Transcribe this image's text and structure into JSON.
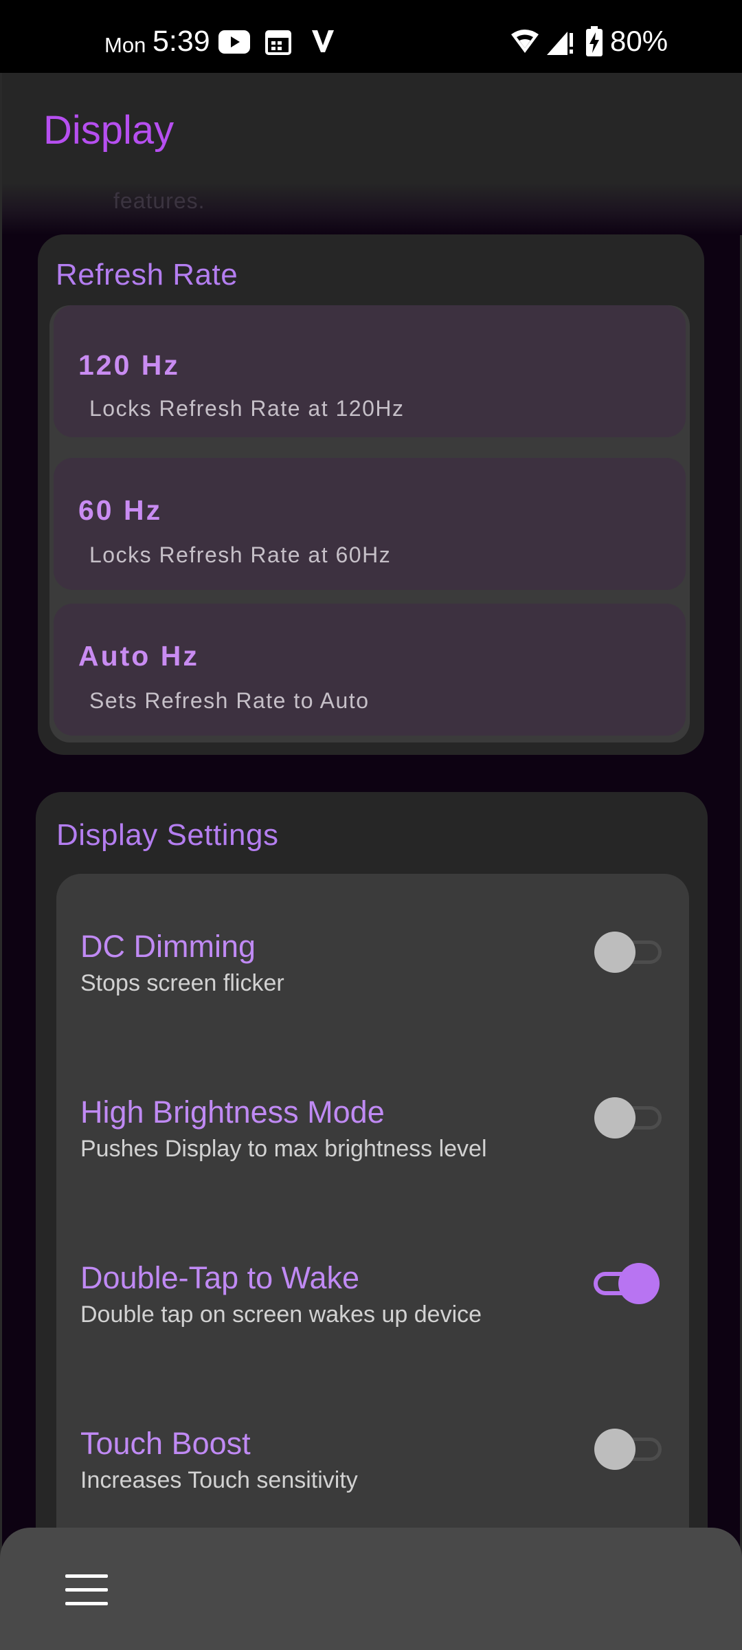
{
  "status_bar": {
    "day": "Mon",
    "time": "5:39",
    "battery": "80%",
    "icons": [
      "youtube-icon",
      "calendar-icon",
      "v-app-icon",
      "wifi-icon",
      "signal-icon",
      "battery-charging-icon"
    ]
  },
  "app_bar": {
    "title": "Display",
    "faded_text": "features."
  },
  "refresh_rate": {
    "title": "Refresh Rate",
    "options": [
      {
        "title": "120 Hz",
        "desc": "Locks Refresh Rate at 120Hz"
      },
      {
        "title": "60 Hz",
        "desc": "Locks Refresh Rate at 60Hz"
      },
      {
        "title": "Auto Hz",
        "desc": "Sets Refresh Rate to Auto"
      }
    ]
  },
  "display_settings": {
    "title": "Display Settings",
    "items": [
      {
        "title": "DC Dimming",
        "desc": "Stops screen flicker",
        "enabled": false
      },
      {
        "title": "High Brightness Mode",
        "desc": "Pushes Display to max brightness level",
        "enabled": false
      },
      {
        "title": "Double-Tap to Wake",
        "desc": "Double tap on screen wakes up device",
        "enabled": true
      },
      {
        "title": "Touch Boost",
        "desc": "Increases Touch sensitivity",
        "enabled": false
      }
    ]
  },
  "bottom_bar": {
    "icon": "menu-icon"
  },
  "colors": {
    "accent": "#b64ff0",
    "card_title": "#b47ef0",
    "toggle_on": "#b874f2",
    "background": "#0d0212"
  }
}
